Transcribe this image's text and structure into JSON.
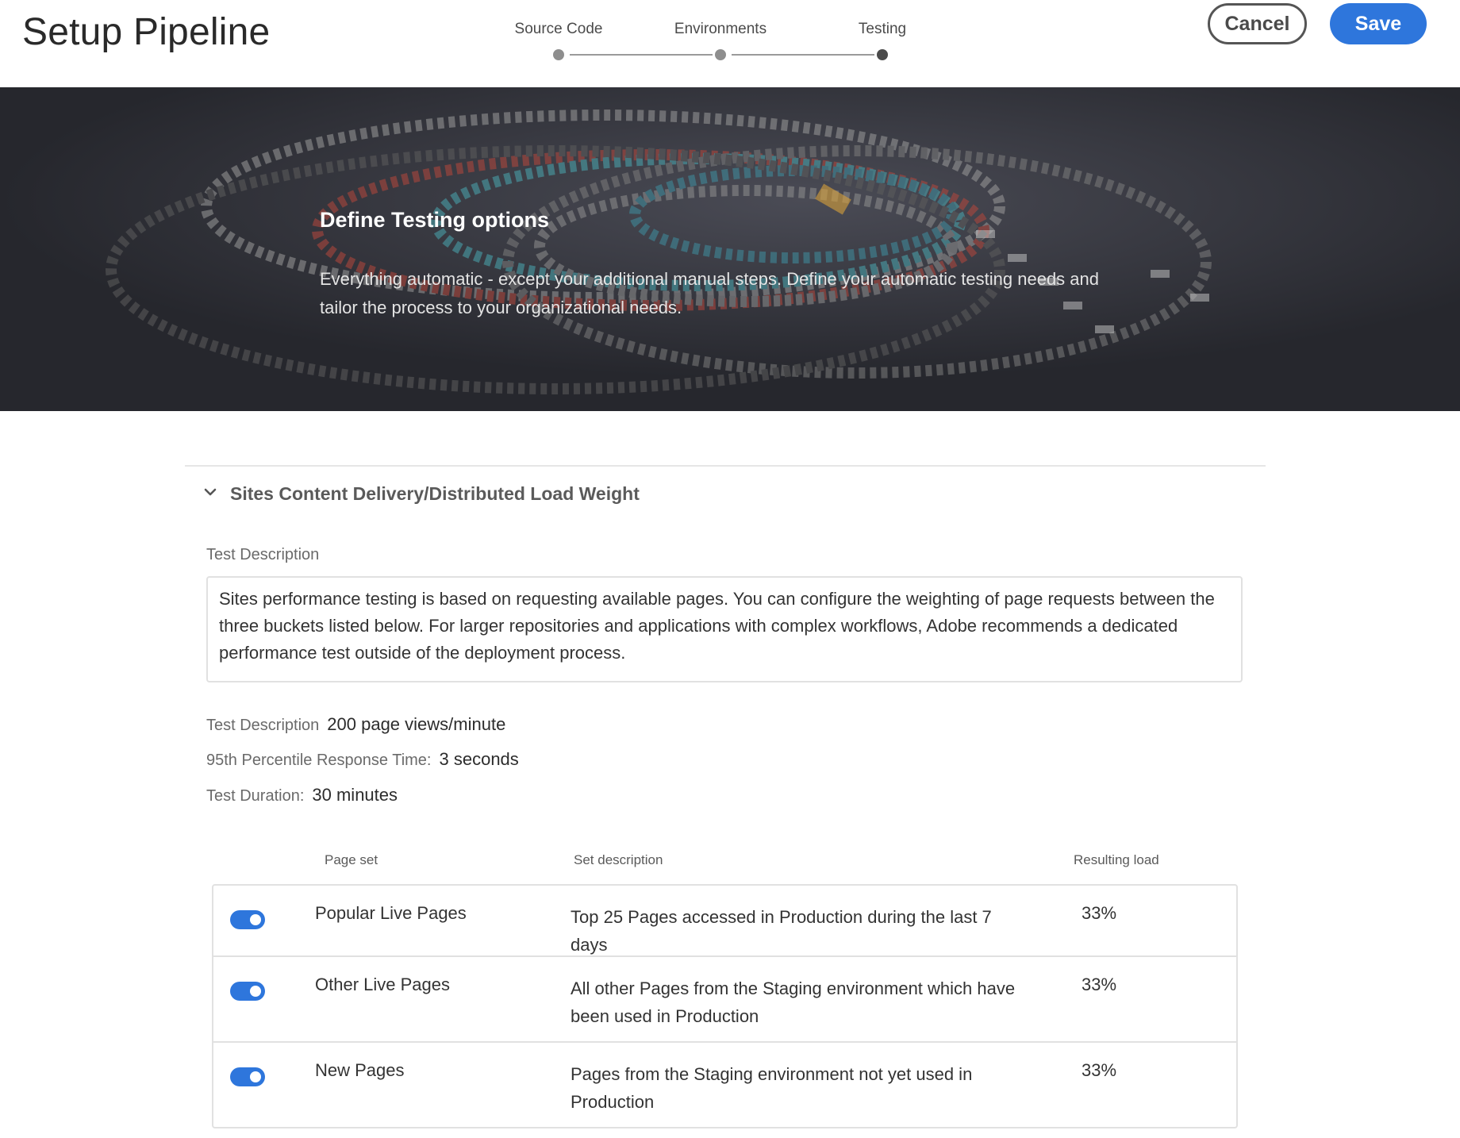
{
  "header": {
    "title": "Setup Pipeline",
    "steps": [
      {
        "label": "Source Code",
        "state": "complete"
      },
      {
        "label": "Environments",
        "state": "complete"
      },
      {
        "label": "Testing",
        "state": "current"
      }
    ],
    "cancel_label": "Cancel",
    "save_label": "Save",
    "colors": {
      "save": "#2e76dc"
    }
  },
  "hero": {
    "title": "Define Testing options",
    "description": "Everything automatic - except your additional manual steps. Define your automatic testing needs and tailor the process to your organizational needs."
  },
  "section": {
    "title": "Sites Content Delivery/Distributed Load Weight",
    "description_label": "Test Description",
    "description_text": "Sites performance testing is based on requesting available pages. You can configure the weighting of page requests between the three buckets listed below. For larger repositories and applications with complex workflows, Adobe recommends a dedicated performance test outside of the deployment process.",
    "fields": [
      {
        "label": "Test Description",
        "value": "200 page views/minute"
      },
      {
        "label": "95th Percentile Response Time:",
        "value": "3 seconds"
      },
      {
        "label": "Test Duration:",
        "value": "30 minutes"
      }
    ]
  },
  "table": {
    "columns": [
      "Page set",
      "Set description",
      "Resulting load"
    ],
    "rows": [
      {
        "enabled": true,
        "name": "Popular Live Pages",
        "description": "Top 25 Pages accessed in Production during the last 7 days",
        "load": "33%"
      },
      {
        "enabled": true,
        "name": "Other Live Pages",
        "description": "All other Pages from the Staging environment which have been used in Production",
        "load": "33%"
      },
      {
        "enabled": true,
        "name": "New Pages",
        "description": "Pages from the Staging environment not yet used in Production",
        "load": "33%"
      }
    ]
  }
}
